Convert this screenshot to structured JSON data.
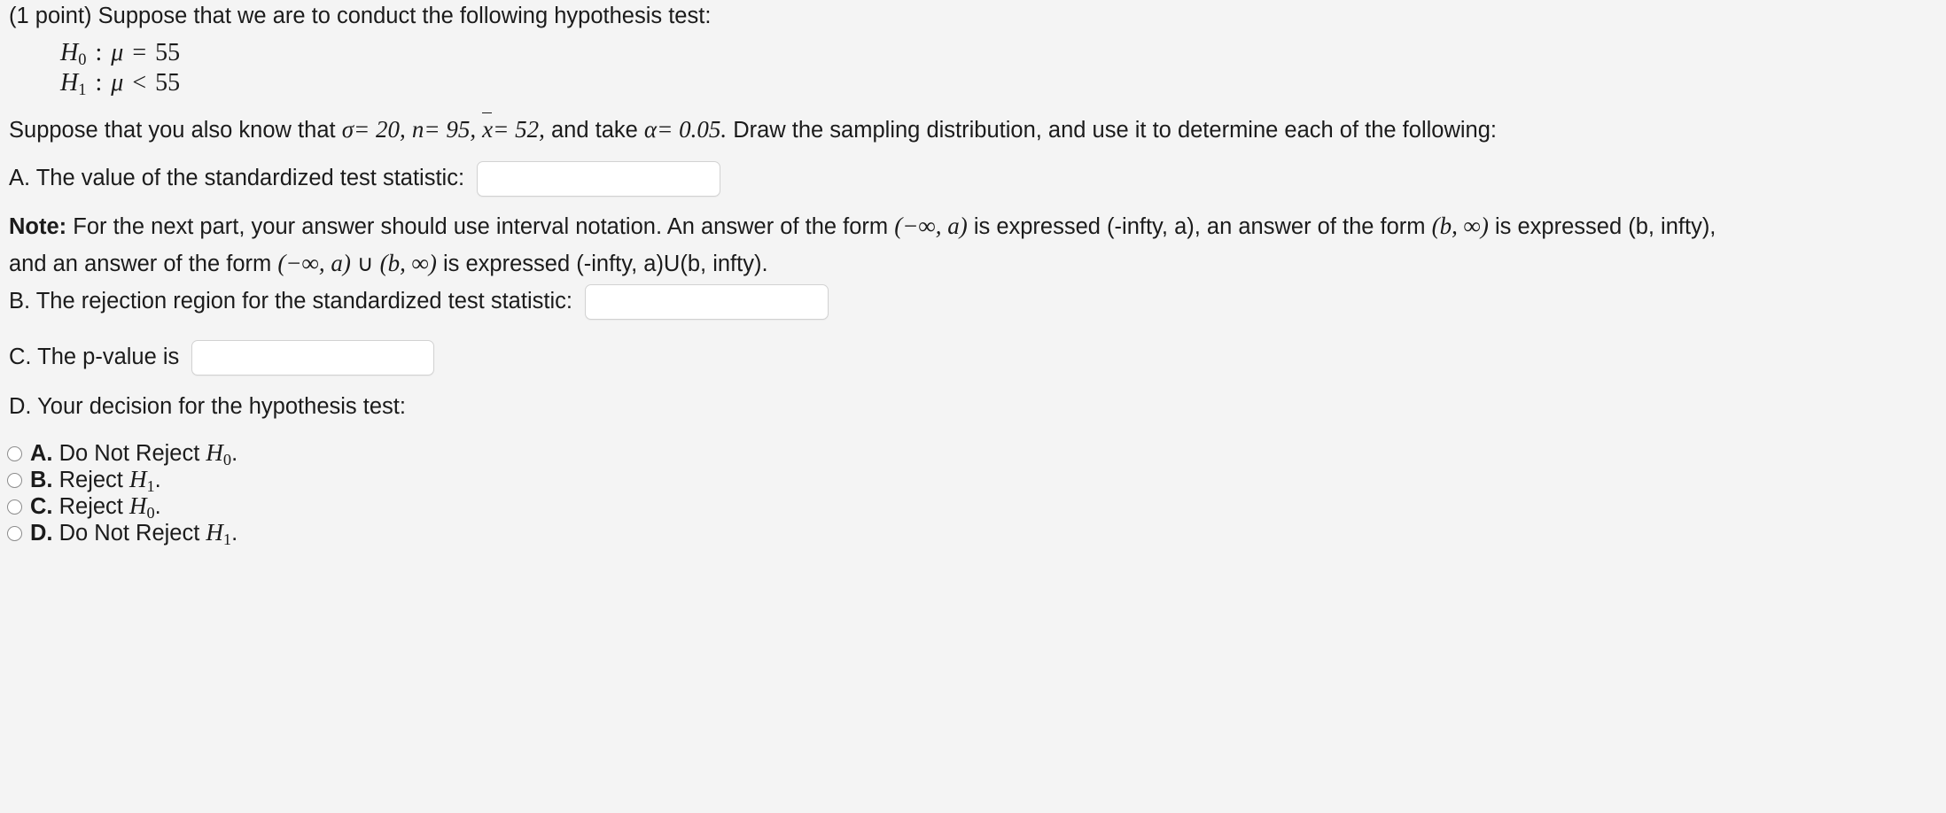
{
  "intro": {
    "points_tag": "(1 point)",
    "text": "Suppose that we are to conduct the following hypothesis test:"
  },
  "hypotheses": [
    {
      "symbol": "H",
      "subscript": "0",
      "relation": ":",
      "parameter": "μ",
      "operator": "=",
      "value": "55"
    },
    {
      "symbol": "H",
      "subscript": "1",
      "relation": ":",
      "parameter": "μ",
      "operator": "<",
      "value": "55"
    }
  ],
  "givens": {
    "lead": "Suppose that you also know that",
    "sigma_symbol": "σ",
    "sigma_value": "= 20,",
    "n_symbol": "n",
    "n_value": "= 95,",
    "xbar_symbol": "x",
    "xbar_value": "= 52,",
    "mid": "and take",
    "alpha_symbol": "α",
    "alpha_value": "= 0.05.",
    "tail": "Draw the sampling distribution, and use it to determine each of the following:"
  },
  "part_a": {
    "label": "A. The value of the standardized test statistic:",
    "value": "",
    "placeholder": ""
  },
  "note": {
    "bold_label": "Note:",
    "line1_a": "For the next part, your answer should use interval notation. An answer of the form",
    "line1_interval1": "(−∞, a)",
    "line1_b": "is expressed (-infty, a), an answer of the form",
    "line1_interval2": "(b, ∞)",
    "line1_c": "is expressed (b, infty),",
    "line2_a": "and an answer of the form",
    "line2_interval1": "(−∞, a)",
    "line2_union": "∪",
    "line2_interval2": "(b, ∞)",
    "line2_b": "is expressed (-infty, a)U(b, infty)."
  },
  "part_b": {
    "label": "B. The rejection region for the standardized test statistic:",
    "value": "",
    "placeholder": ""
  },
  "part_c": {
    "label": "C. The p-value is",
    "value": "",
    "placeholder": ""
  },
  "part_d": {
    "label": "D. Your decision for the hypothesis test:",
    "options": [
      {
        "letter": "A.",
        "text_before": "Do Not Reject",
        "symbol": "H",
        "subscript": "0",
        "text_after": ".",
        "selected": false
      },
      {
        "letter": "B.",
        "text_before": "Reject",
        "symbol": "H",
        "subscript": "1",
        "text_after": ".",
        "selected": false
      },
      {
        "letter": "C.",
        "text_before": "Reject",
        "symbol": "H",
        "subscript": "0",
        "text_after": ".",
        "selected": false
      },
      {
        "letter": "D.",
        "text_before": "Do Not Reject",
        "symbol": "H",
        "subscript": "1",
        "text_after": ".",
        "selected": false
      }
    ]
  },
  "colors": {
    "background": "#f4f4f4",
    "text": "#1b1b1b",
    "input_border": "#d2d2d2",
    "input_background": "#ffffff",
    "radio_border": "#8c8c8c"
  }
}
